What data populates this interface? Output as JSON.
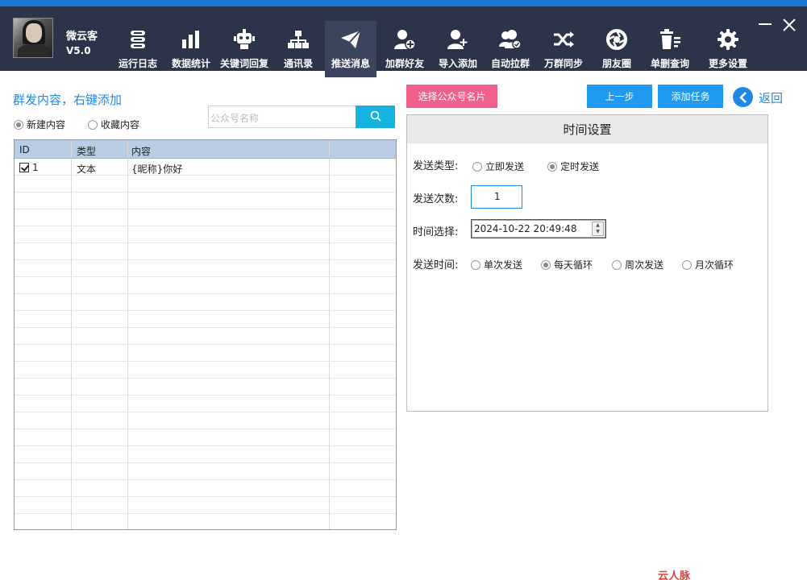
{
  "app": {
    "name": "微云客",
    "version": "V5.0"
  },
  "nav": [
    {
      "label": "运行日志",
      "icon": "log-icon"
    },
    {
      "label": "数据统计",
      "icon": "bar-chart-icon"
    },
    {
      "label": "关键词回复",
      "icon": "robot-icon"
    },
    {
      "label": "通讯录",
      "icon": "org-chart-icon"
    },
    {
      "label": "推送消息",
      "icon": "paper-plane-icon",
      "active": true
    },
    {
      "label": "加群好友",
      "icon": "add-contact-icon"
    },
    {
      "label": "导入添加",
      "icon": "import-user-icon"
    },
    {
      "label": "自动拉群",
      "icon": "group-check-icon"
    },
    {
      "label": "万群同步",
      "icon": "shuffle-icon"
    },
    {
      "label": "朋友圈",
      "icon": "aperture-icon"
    },
    {
      "label": "单删查询",
      "icon": "trash-icon"
    },
    {
      "label": "更多设置",
      "icon": "gear-icon"
    }
  ],
  "left": {
    "title": "群发内容，右键添加",
    "radios": [
      {
        "label": "新建内容",
        "selected": true
      },
      {
        "label": "收藏内容",
        "selected": false
      }
    ],
    "search_placeholder": "公众号名称",
    "table": {
      "headers": [
        "ID",
        "类型",
        "内容"
      ],
      "rows": [
        {
          "checked": true,
          "id": "1",
          "type": "文本",
          "content": "{昵称}你好"
        }
      ]
    }
  },
  "right": {
    "select_card_button": "选择公众号名片",
    "prev_button": "上一步",
    "add_task_button": "添加任务",
    "back_label": "返回",
    "panel_title": "时间设置",
    "send_type_label": "发送类型:",
    "send_type_options": [
      {
        "label": "立即发送",
        "selected": false
      },
      {
        "label": "定时发送",
        "selected": true
      }
    ],
    "send_count_label": "发送次数:",
    "send_count_value": "1",
    "time_select_label": "时间选择:",
    "time_value": "2024-10-22 20:49:48",
    "send_time_label": "发送时间:",
    "send_time_options": [
      {
        "label": "单次发送",
        "selected": false
      },
      {
        "label": "每天循环",
        "selected": true
      },
      {
        "label": "周次发送",
        "selected": false
      },
      {
        "label": "月次循环",
        "selected": false
      }
    ]
  },
  "watermark": "云人脉www.yunyunvip.com",
  "colors": {
    "topbar": "#2b3449",
    "accent": "#1e88e5",
    "pink": "#f0608a",
    "search": "#17b3e0"
  }
}
